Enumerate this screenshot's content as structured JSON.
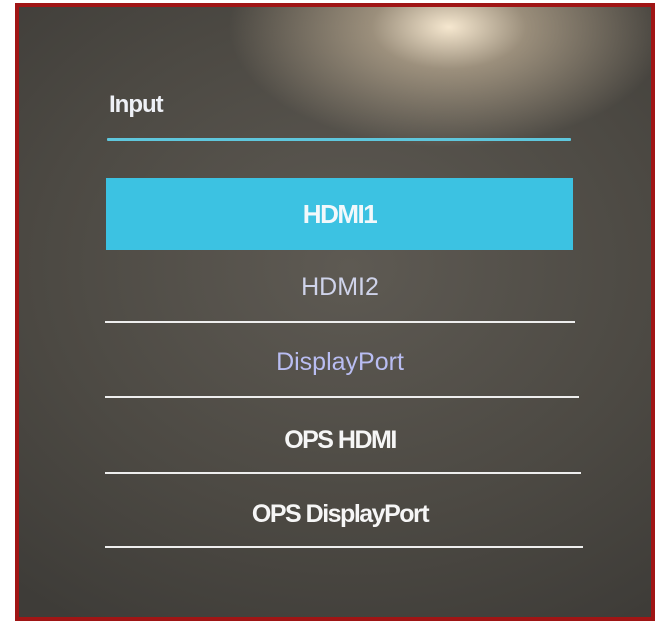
{
  "menu": {
    "title": "Input",
    "options": [
      {
        "label": "HDMI1",
        "selected": true
      },
      {
        "label": "HDMI2",
        "selected": false
      },
      {
        "label": "DisplayPort",
        "selected": false
      },
      {
        "label": "OPS HDMI",
        "selected": false
      },
      {
        "label": "OPS DisplayPort",
        "selected": false
      }
    ]
  },
  "colors": {
    "selection_highlight": "#3cc2e2",
    "title_underline": "#5fc7dd",
    "frame_border": "#a01515",
    "screen_background": "#4c4943"
  }
}
